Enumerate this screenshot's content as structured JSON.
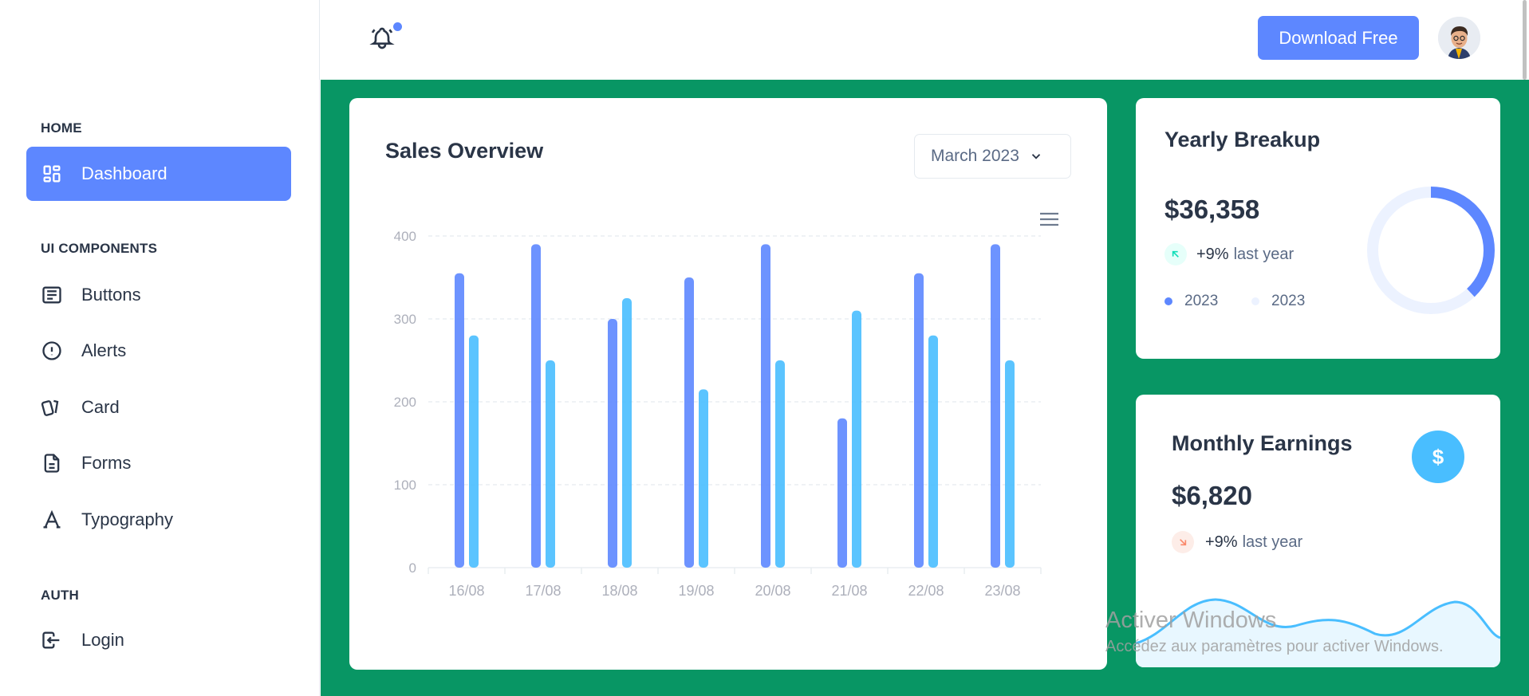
{
  "sidebar": {
    "sections": [
      {
        "title": "HOME"
      },
      {
        "title": "UI COMPONENTS"
      },
      {
        "title": "AUTH"
      }
    ],
    "items": [
      {
        "label": "Dashboard",
        "icon": "dashboard-icon",
        "active": true
      },
      {
        "label": "Buttons",
        "icon": "article-icon"
      },
      {
        "label": "Alerts",
        "icon": "alert-circle-icon"
      },
      {
        "label": "Card",
        "icon": "cards-icon"
      },
      {
        "label": "Forms",
        "icon": "file-description-icon"
      },
      {
        "label": "Typography",
        "icon": "typography-icon"
      },
      {
        "label": "Login",
        "icon": "login-icon"
      }
    ]
  },
  "header": {
    "notification_icon": "bell-ringing-icon",
    "download_label": "Download Free",
    "avatar_icon": "user-avatar-icon"
  },
  "sales_overview": {
    "title": "Sales Overview",
    "month_selected": "March 2023",
    "menu_icon": "hamburger-menu-icon"
  },
  "yearly_breakup": {
    "title": "Yearly Breakup",
    "value": "$36,358",
    "trend_pct": "+9%",
    "trend_text": "last year",
    "legend": [
      {
        "label": "2023",
        "color": "#5d87ff"
      },
      {
        "label": "2023",
        "color": "#ecf2ff"
      }
    ],
    "donut": {
      "primary_fraction": 0.38,
      "primary_color": "#5d87ff",
      "secondary_color": "#ecf2ff"
    }
  },
  "monthly_earnings": {
    "title": "Monthly Earnings",
    "value": "$6,820",
    "trend_pct": "+9%",
    "trend_text": "last year",
    "dollar_icon": "$"
  },
  "watermark": {
    "title": "Activer Windows",
    "subtitle": "Accédez aux paramètres pour activer Windows."
  },
  "colors": {
    "primary": "#5d87ff",
    "secondary": "#49beff",
    "background_green": "#089664"
  },
  "chart_data": {
    "type": "bar",
    "categories": [
      "16/08",
      "17/08",
      "18/08",
      "19/08",
      "20/08",
      "21/08",
      "22/08",
      "23/08"
    ],
    "series": [
      {
        "values": [
          355,
          390,
          300,
          350,
          390,
          180,
          355,
          390
        ],
        "color": "#5d87ff"
      },
      {
        "values": [
          280,
          250,
          325,
          215,
          250,
          310,
          280,
          250
        ],
        "color": "#49beff"
      }
    ],
    "yticks": [
      0,
      100,
      200,
      300,
      400
    ],
    "ylim": [
      0,
      400
    ],
    "grid": true,
    "title": "",
    "xlabel": "",
    "ylabel": ""
  }
}
